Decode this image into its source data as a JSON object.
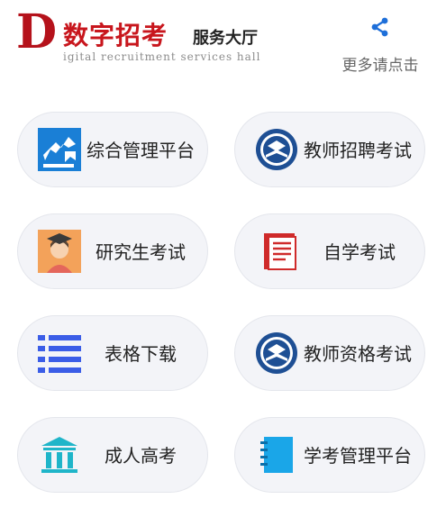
{
  "header": {
    "logo_letter": "D",
    "logo_main": "数字招考",
    "logo_sub": "服务大厅",
    "logo_english": "igital recruitment services hall",
    "share_icon": "share-icon",
    "share_label": "更多请点击"
  },
  "tiles": [
    {
      "label": "综合管理平台",
      "icon": "arrows-icon"
    },
    {
      "label": "教师招聘考试",
      "icon": "emblem-icon"
    },
    {
      "label": "研究生考试",
      "icon": "graduate-icon"
    },
    {
      "label": "自学考试",
      "icon": "document-icon"
    },
    {
      "label": "表格下载",
      "icon": "list-icon"
    },
    {
      "label": "教师资格考试",
      "icon": "emblem-icon"
    },
    {
      "label": "成人高考",
      "icon": "building-icon"
    },
    {
      "label": "学考管理平台",
      "icon": "notebook-icon"
    }
  ],
  "colors": {
    "brand_red": "#c8161d",
    "share_blue": "#1e6fd9",
    "tile_bg": "#f3f4f8"
  }
}
